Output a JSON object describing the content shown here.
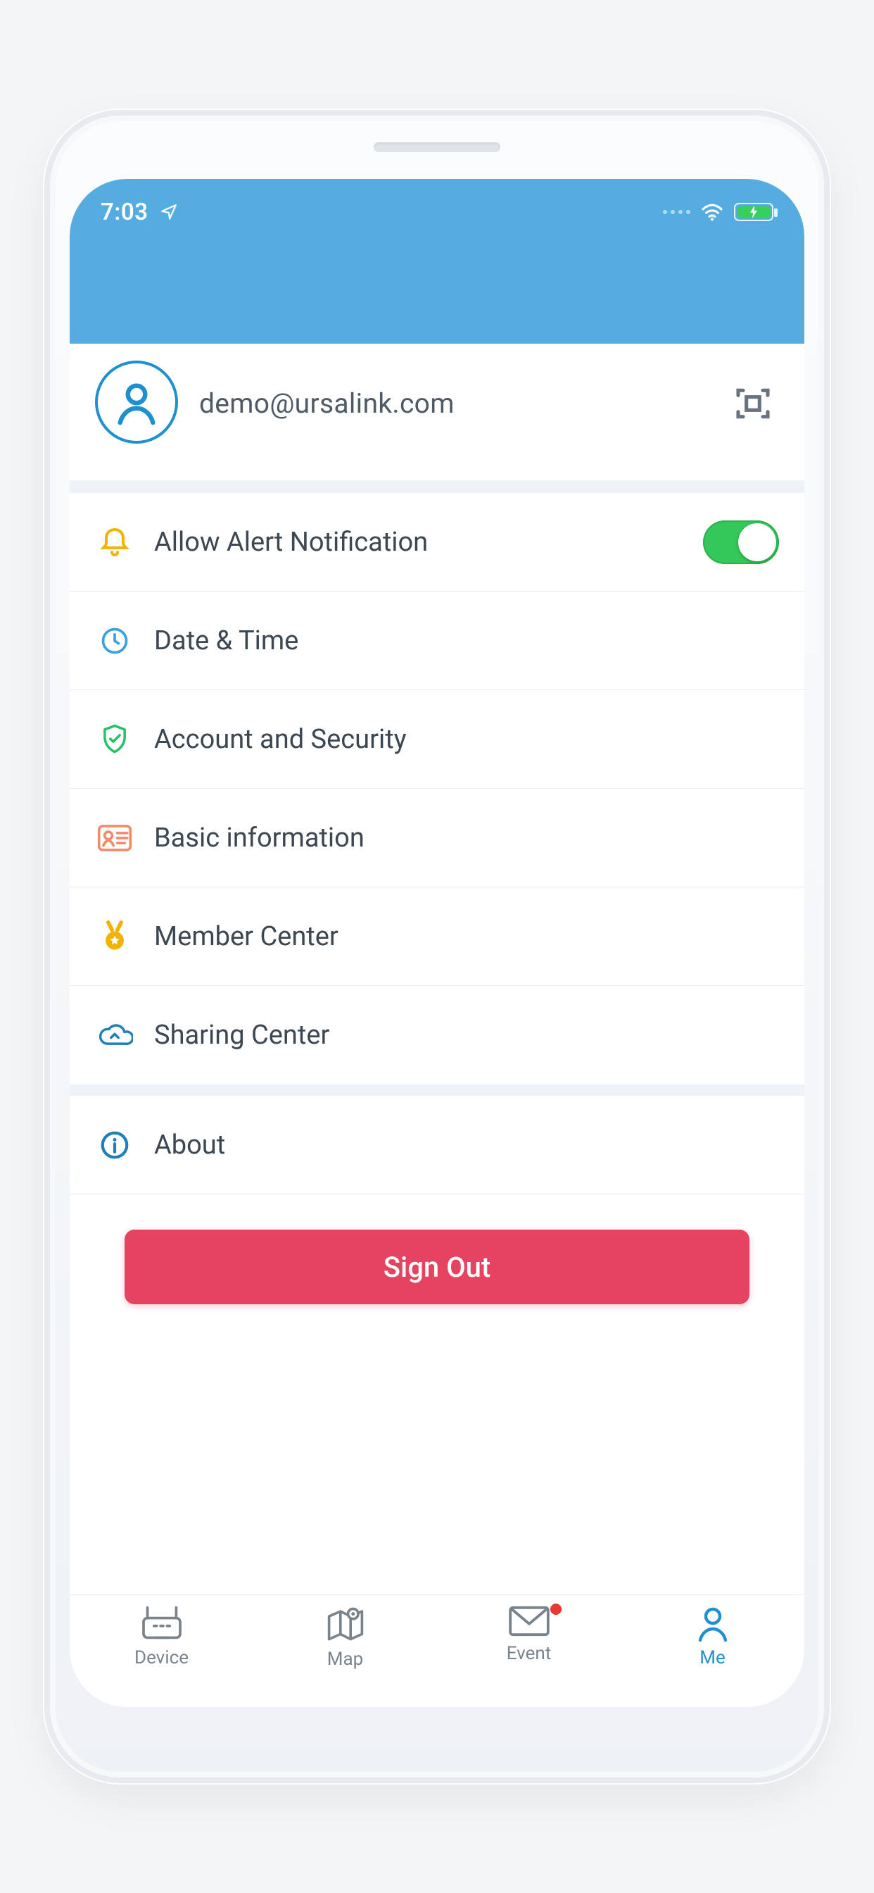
{
  "status": {
    "time": "7:03"
  },
  "profile": {
    "email": "demo@ursalink.com"
  },
  "settings": {
    "alert_label": "Allow Alert Notification",
    "alert_on": true,
    "date_time_label": "Date & Time",
    "security_label": "Account and Security",
    "basic_info_label": "Basic information",
    "member_center_label": "Member Center",
    "sharing_center_label": "Sharing Center",
    "about_label": "About"
  },
  "signout_label": "Sign Out",
  "tabs": {
    "device": "Device",
    "map": "Map",
    "event": "Event",
    "me": "Me",
    "event_has_badge": true,
    "active": "me"
  }
}
